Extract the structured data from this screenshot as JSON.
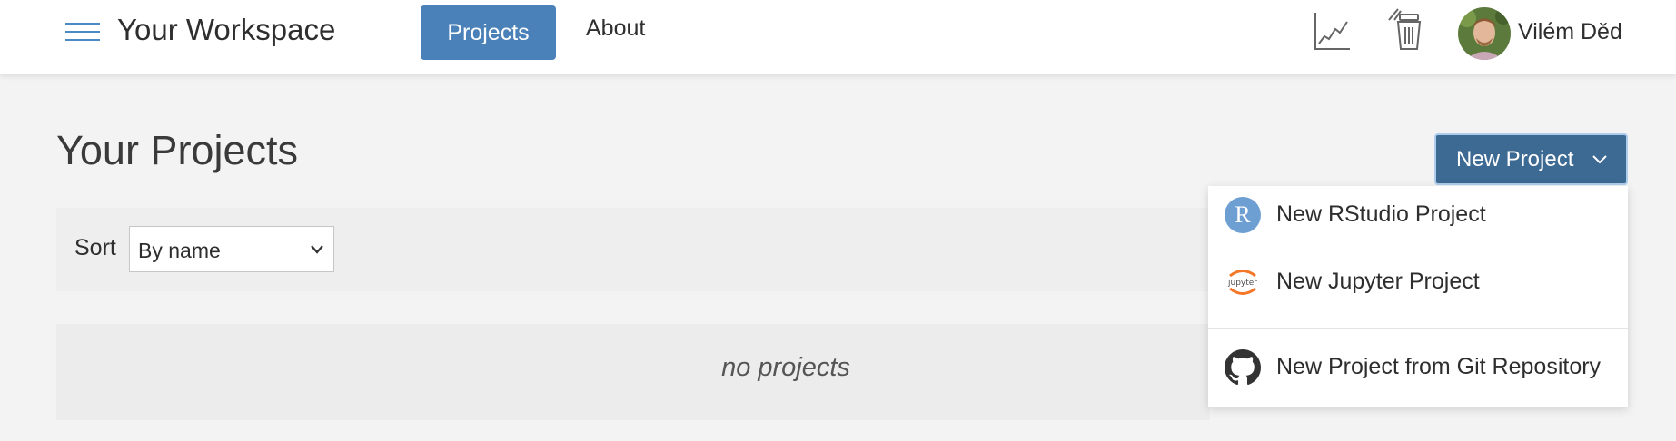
{
  "header": {
    "menu_icon": "hamburger-menu-icon",
    "brand": "Your Workspace",
    "nav": [
      {
        "label": "Projects",
        "active": true
      },
      {
        "label": "About",
        "active": false
      }
    ],
    "icons": [
      "line-chart-icon",
      "trash-icon"
    ],
    "user_name": "Vilém Děd"
  },
  "main": {
    "title": "Your Projects",
    "new_project_button": "New Project",
    "sort": {
      "label": "Sort",
      "selected": "By name"
    },
    "empty_message": "no projects"
  },
  "dropdown": {
    "items": [
      {
        "label": "New RStudio Project",
        "icon": "rstudio-icon",
        "icon_text": "R"
      },
      {
        "label": "New Jupyter Project",
        "icon": "jupyter-icon",
        "icon_text": "jupyter"
      },
      {
        "label": "New Project from Git Repository",
        "icon": "github-icon"
      }
    ]
  },
  "colors": {
    "primary": "#4a81b9",
    "primary_dark": "#3d6a93",
    "rstudio": "#6e9fd3",
    "jupyter": "#f37726"
  }
}
